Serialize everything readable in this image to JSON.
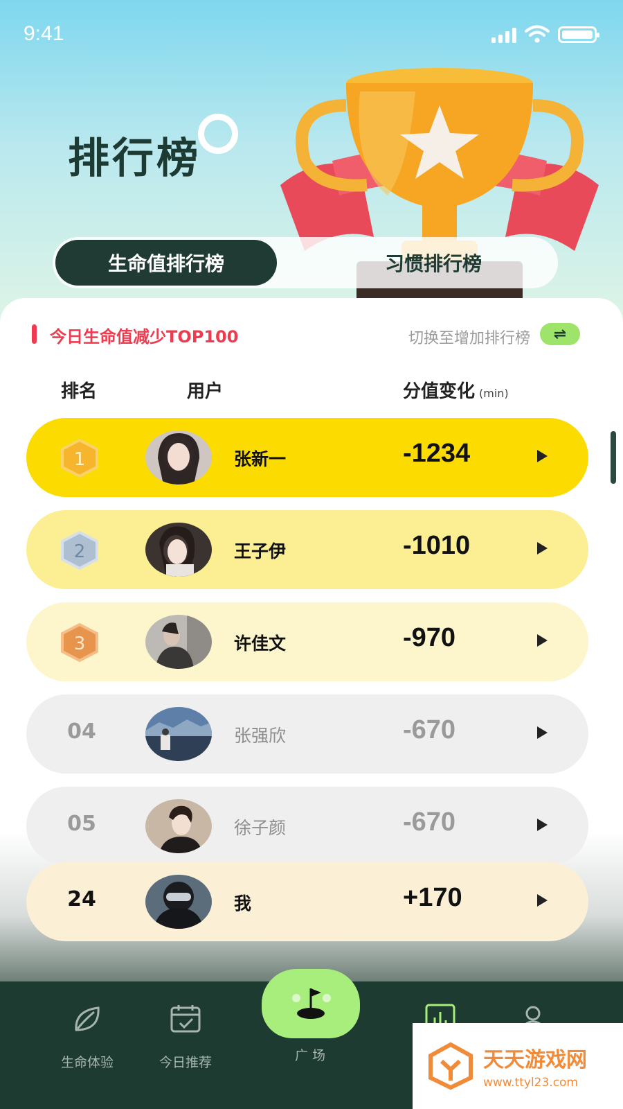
{
  "status_bar": {
    "time": "9:41"
  },
  "header": {
    "title": "排行榜"
  },
  "tabs": [
    {
      "label": "生命值排行榜",
      "active": true
    },
    {
      "label": "习惯排行榜",
      "active": false
    }
  ],
  "section": {
    "title": "今日生命值减少TOP100",
    "switch_label": "切换至增加排行榜",
    "switch_icon": "⇌"
  },
  "columns": {
    "rank": "排名",
    "user": "用户",
    "score": "分值变化",
    "unit": "(min)"
  },
  "rows": [
    {
      "rank": "1",
      "name": "张新一",
      "score": "-1234",
      "bg": "#fcdc00",
      "badge": "gold"
    },
    {
      "rank": "2",
      "name": "王子伊",
      "score": "-1010",
      "bg": "#fcee93",
      "badge": "silver"
    },
    {
      "rank": "3",
      "name": "许佳文",
      "score": "-970",
      "bg": "#fdf6cc",
      "badge": "bronze"
    },
    {
      "rank": "04",
      "name": "张强欣",
      "score": "-670",
      "bg": "#efefef",
      "badge": "none"
    },
    {
      "rank": "05",
      "name": "徐子颜",
      "score": "-670",
      "bg": "#efefef",
      "badge": "none"
    },
    {
      "rank": "24",
      "name": "我",
      "score": "+170",
      "bg": "#fbefd6",
      "badge": "none"
    }
  ],
  "nav": {
    "items": [
      {
        "label": "生命体验",
        "icon": "leaf-icon"
      },
      {
        "label": "今日推荐",
        "icon": "calendar-check-icon"
      },
      {
        "label": "广 场",
        "icon": "golf-flag-icon"
      },
      {
        "label": "",
        "icon": "bar-chart-icon"
      },
      {
        "label": "",
        "icon": "user-icon"
      }
    ]
  },
  "watermark": {
    "main": "天天游戏网",
    "sub": "www.ttyl23.com"
  },
  "colors": {
    "accent_dark": "#1f3b33",
    "accent_green": "#a8ee7c",
    "alert_red": "#ef3b50",
    "gold": "#fcdc00"
  }
}
